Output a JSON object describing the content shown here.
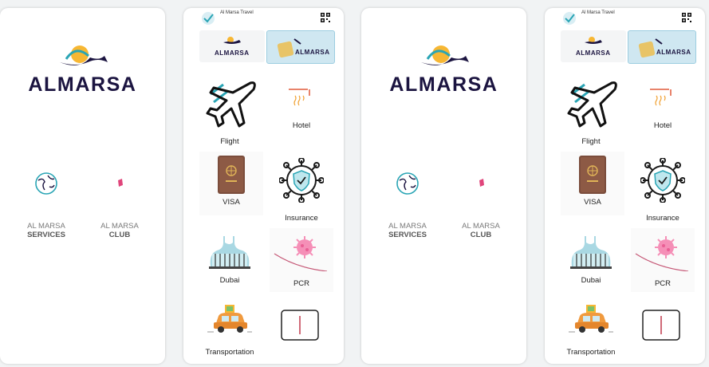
{
  "splash": {
    "brand": "ALMARSA",
    "services": [
      {
        "line1": "AL MARSA",
        "line2": "SERVICES",
        "icon": "globe-icon"
      },
      {
        "line1": "AL MARSA",
        "line2": "CLUB",
        "icon": "club-icon"
      }
    ]
  },
  "menu": {
    "title": "Al Marsa Travel",
    "banner_text": "ALMARSA",
    "items": [
      {
        "label": "Flight",
        "icon": "airplane-icon"
      },
      {
        "label": "Hotel",
        "icon": "hotel-icon"
      },
      {
        "label": "VISA",
        "icon": "passport-icon"
      },
      {
        "label": "Insurance",
        "icon": "shield-virus-icon"
      },
      {
        "label": "Dubai",
        "icon": "dubai-icon"
      },
      {
        "label": "PCR",
        "icon": "virus-icon"
      },
      {
        "label": "Transportation",
        "icon": "car-icon"
      }
    ]
  },
  "colors": {
    "brand": "#1b1440",
    "teal": "#2aa5b5",
    "accent": "#f7b733"
  }
}
